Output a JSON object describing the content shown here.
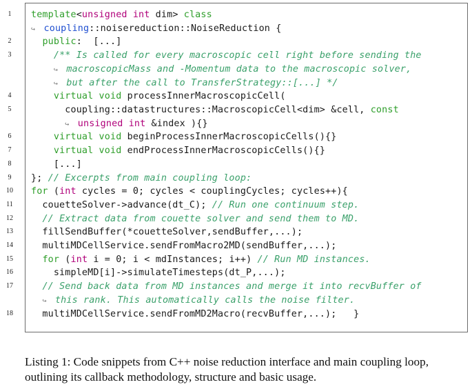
{
  "listing": {
    "lines": [
      {
        "num": "1",
        "parts": [
          [
            "kw",
            "template"
          ],
          [
            "",
            "<"
          ],
          [
            "ty",
            "unsigned int"
          ],
          [
            "",
            " dim> "
          ],
          [
            "kw",
            "class"
          ]
        ]
      },
      {
        "num": "",
        "cont": true,
        "parts": [
          [
            "ns",
            "coupling"
          ],
          [
            "",
            "::noisereduction::NoiseReduction {"
          ]
        ]
      },
      {
        "num": "2",
        "parts": [
          [
            "",
            "  "
          ],
          [
            "kw",
            "public"
          ],
          [
            "",
            ":  [...]"
          ]
        ]
      },
      {
        "num": "3",
        "parts": [
          [
            "",
            "    "
          ],
          [
            "cm",
            "/** Is called for every macroscopic cell right before sending the"
          ]
        ]
      },
      {
        "num": "",
        "cont": true,
        "indent": "    ",
        "parts": [
          [
            "cm",
            "macroscopicMass and -Momentum data to the macroscopic solver,"
          ]
        ]
      },
      {
        "num": "",
        "cont": true,
        "indent": "    ",
        "parts": [
          [
            "cm",
            "but after the call to TransferStrategy::[...] */"
          ]
        ]
      },
      {
        "num": "4",
        "parts": [
          [
            "",
            "    "
          ],
          [
            "kw",
            "virtual void"
          ],
          [
            "",
            " processInnerMacroscopicCell("
          ]
        ]
      },
      {
        "num": "5",
        "parts": [
          [
            "",
            "      coupling::datastructures::MacroscopicCell<dim> &cell, "
          ],
          [
            "kw",
            "const"
          ]
        ]
      },
      {
        "num": "",
        "cont": true,
        "indent": "      ",
        "parts": [
          [
            "ty",
            "unsigned int"
          ],
          [
            "",
            " &index ){}"
          ]
        ]
      },
      {
        "num": "6",
        "parts": [
          [
            "",
            "    "
          ],
          [
            "kw",
            "virtual void"
          ],
          [
            "",
            " beginProcessInnerMacroscopicCells(){}"
          ]
        ]
      },
      {
        "num": "7",
        "parts": [
          [
            "",
            "    "
          ],
          [
            "kw",
            "virtual void"
          ],
          [
            "",
            " endProcessInnerMacroscopicCells(){}"
          ]
        ]
      },
      {
        "num": "8",
        "parts": [
          [
            "",
            "    [...]"
          ]
        ]
      },
      {
        "num": "9",
        "parts": [
          [
            "",
            "}; "
          ],
          [
            "cm",
            "// Excerpts from main coupling loop:"
          ]
        ]
      },
      {
        "num": "10",
        "parts": [
          [
            "kw",
            "for"
          ],
          [
            "",
            " ("
          ],
          [
            "ty",
            "int"
          ],
          [
            "",
            " cycles = 0; cycles < couplingCycles; cycles++){"
          ]
        ]
      },
      {
        "num": "11",
        "parts": [
          [
            "",
            "  couetteSolver->advance(dt_C); "
          ],
          [
            "cm",
            "// Run one continuum step."
          ]
        ]
      },
      {
        "num": "12",
        "parts": [
          [
            "",
            "  "
          ],
          [
            "cm",
            "// Extract data from couette solver and send them to MD."
          ]
        ]
      },
      {
        "num": "13",
        "parts": [
          [
            "",
            "  fillSendBuffer(*couetteSolver,sendBuffer,...);"
          ]
        ]
      },
      {
        "num": "14",
        "parts": [
          [
            "",
            "  multiMDCellService.sendFromMacro2MD(sendBuffer,...);"
          ]
        ]
      },
      {
        "num": "15",
        "parts": [
          [
            "",
            "  "
          ],
          [
            "kw",
            "for"
          ],
          [
            "",
            " ("
          ],
          [
            "ty",
            "int"
          ],
          [
            "",
            " i = 0; i < mdInstances; i++) "
          ],
          [
            "cm",
            "// Run MD instances."
          ]
        ]
      },
      {
        "num": "16",
        "parts": [
          [
            "",
            "    simpleMD[i]->simulateTimesteps(dt_P,...);"
          ]
        ]
      },
      {
        "num": "17",
        "parts": [
          [
            "",
            "  "
          ],
          [
            "cm",
            "// Send back data from MD instances and merge it into recvBuffer of"
          ]
        ]
      },
      {
        "num": "",
        "cont": true,
        "indent": "  ",
        "parts": [
          [
            "cm",
            "this rank. This automatically calls the noise filter."
          ]
        ]
      },
      {
        "num": "18",
        "parts": [
          [
            "",
            "  multiMDCellService.sendFromMD2Macro(recvBuffer,...);   }"
          ]
        ]
      }
    ],
    "continuation_glyph": "↪"
  },
  "caption": {
    "text": "Listing 1: Code snippets from C++ noise reduction interface and main coupling loop, outlining its callback methodology, structure and basic usage."
  }
}
